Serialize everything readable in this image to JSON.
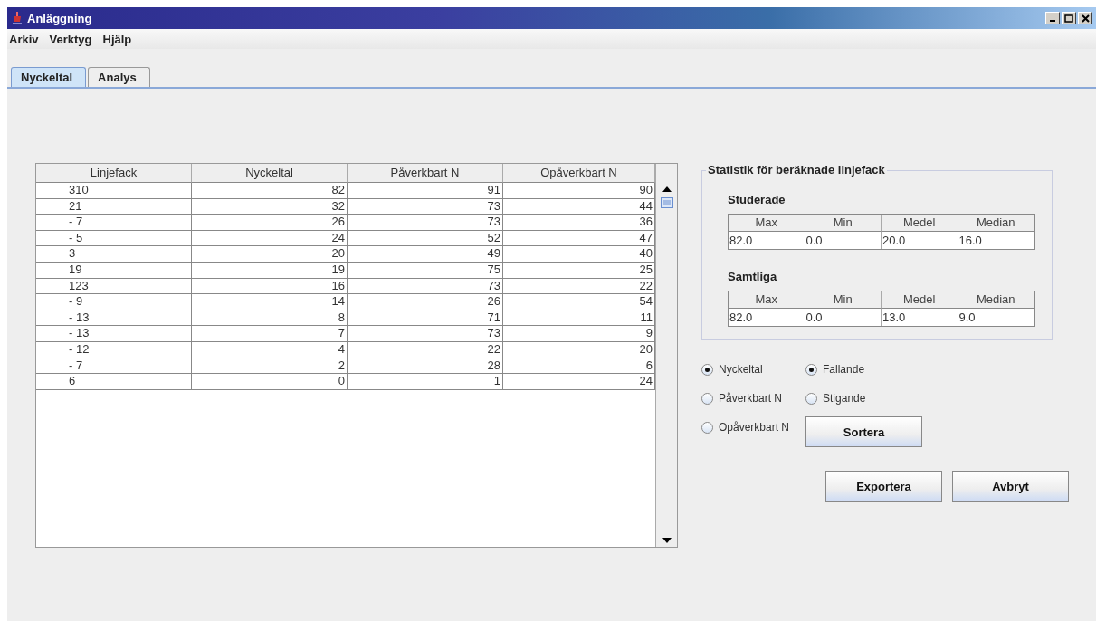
{
  "window": {
    "title": "Anläggning"
  },
  "menu": [
    "Arkiv",
    "Verktyg",
    "Hjälp"
  ],
  "tabs": [
    {
      "label": "Nyckeltal",
      "selected": true
    },
    {
      "label": "Analys",
      "selected": false
    }
  ],
  "table": {
    "columns": [
      "Linjefack",
      "Nyckeltal",
      "Påverkbart N",
      "Opåverkbart N"
    ],
    "rows": [
      [
        "310",
        "82",
        "91",
        "90"
      ],
      [
        "21",
        "32",
        "73",
        "44"
      ],
      [
        "- 7",
        "26",
        "73",
        "36"
      ],
      [
        "- 5",
        "24",
        "52",
        "47"
      ],
      [
        "3",
        "20",
        "49",
        "40"
      ],
      [
        "19",
        "19",
        "75",
        "25"
      ],
      [
        "123",
        "16",
        "73",
        "22"
      ],
      [
        "- 9",
        "14",
        "26",
        "54"
      ],
      [
        "- 13",
        "8",
        "71",
        "11"
      ],
      [
        "- 13",
        "7",
        "73",
        "9"
      ],
      [
        "- 12",
        "4",
        "22",
        "20"
      ],
      [
        "- 7",
        "2",
        "28",
        "6"
      ],
      [
        "6",
        "0",
        "1",
        "24"
      ]
    ]
  },
  "statistics": {
    "title": "Statistik för beräknade linjefack",
    "groups": [
      {
        "title": "Studerade",
        "columns": [
          "Max",
          "Min",
          "Medel",
          "Median"
        ],
        "values": [
          "82.0",
          "0.0",
          "20.0",
          "16.0"
        ]
      },
      {
        "title": "Samtliga",
        "columns": [
          "Max",
          "Min",
          "Medel",
          "Median"
        ],
        "values": [
          "82.0",
          "0.0",
          "13.0",
          "9.0"
        ]
      }
    ]
  },
  "sort_by": [
    {
      "label": "Nyckeltal",
      "selected": true
    },
    {
      "label": "Påverkbart N",
      "selected": false
    },
    {
      "label": "Opåverkbart N",
      "selected": false
    }
  ],
  "order": [
    {
      "label": "Fallande",
      "selected": true
    },
    {
      "label": "Stigande",
      "selected": false
    }
  ],
  "sort_button": "Sortera",
  "buttons": [
    "Exportera",
    "Avbryt"
  ]
}
